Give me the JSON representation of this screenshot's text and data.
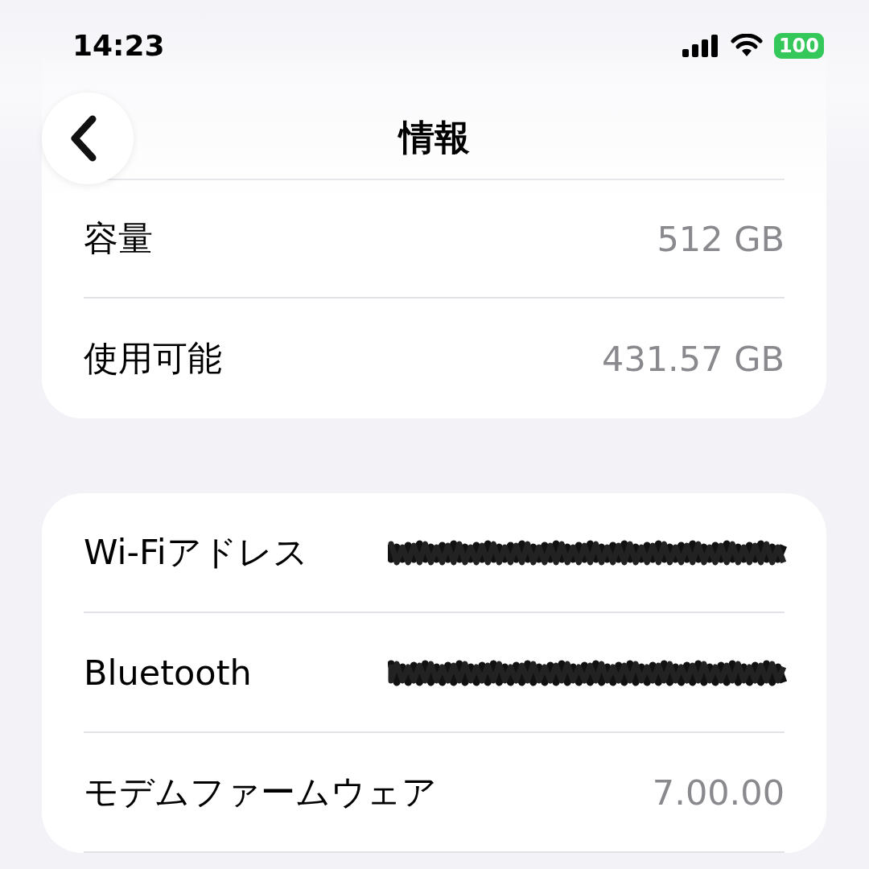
{
  "status_bar": {
    "time": "14:23",
    "battery": "100"
  },
  "nav": {
    "title": "情報"
  },
  "groups": [
    {
      "rows": [
        {
          "label": "容量",
          "value": "512 GB",
          "kind": "plain"
        },
        {
          "label": "使用可能",
          "value": "431.57 GB",
          "kind": "plain"
        }
      ]
    },
    {
      "rows": [
        {
          "label": "Wi-Fiアドレス",
          "kind": "redacted"
        },
        {
          "label": "Bluetooth",
          "kind": "redacted"
        },
        {
          "label": "モデムファームウェア",
          "value": "7.00.00",
          "kind": "plain"
        }
      ]
    }
  ]
}
